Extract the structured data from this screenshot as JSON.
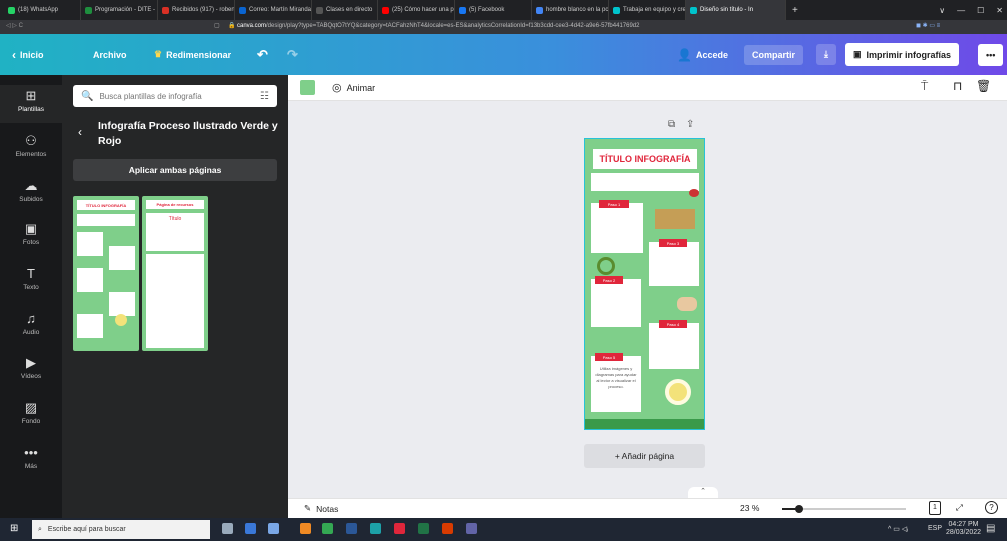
{
  "browser": {
    "tabs": [
      {
        "label": "(18) WhatsApp",
        "color": "#25d366"
      },
      {
        "label": "Programación - DITE - D",
        "color": "#1e8e3e"
      },
      {
        "label": "Recibidos (917) - roberto",
        "color": "#d93025"
      },
      {
        "label": "Correo: Martín Miranda",
        "color": "#0a64d0"
      },
      {
        "label": "Clases en directo",
        "color": "#555555"
      },
      {
        "label": "(25) Cómo hacer una pr",
        "color": "#ff0000"
      },
      {
        "label": "(5) Facebook",
        "color": "#1877f2"
      },
      {
        "label": "hombre blanco en la pc",
        "color": "#4285f4"
      },
      {
        "label": "Trabaja en equipo y crea",
        "color": "#00c4cc"
      },
      {
        "label": "Diseño sin título - In",
        "color": "#00c4cc"
      }
    ],
    "window_controls": [
      "∨",
      "—",
      "☐",
      "✕"
    ],
    "url_domain": "canva.com",
    "url_path": "/design/play?type=TABQqtO7tYQ&category=tACFahzNhT4&locale=es-ES&analyticsCorrelationId=f13b3cdd-cee3-4d42-a9e6-57fb441769d2"
  },
  "toolbar": {
    "home_label": "Inicio",
    "file_label": "Archivo",
    "resize_label": "Redimensionar",
    "undo_icon": "undo-icon",
    "redo_icon": "redo-icon",
    "account_label": "Accede",
    "share_label": "Compartir",
    "print_label": "Imprimir infografías",
    "more_label": "•••"
  },
  "rail": {
    "items": [
      {
        "label": "Plantillas",
        "glyph": "⊞"
      },
      {
        "label": "Elementos",
        "glyph": "⚇"
      },
      {
        "label": "Subidos",
        "glyph": "☁"
      },
      {
        "label": "Fotos",
        "glyph": "▣"
      },
      {
        "label": "Texto",
        "glyph": "T"
      },
      {
        "label": "Audio",
        "glyph": "♫"
      },
      {
        "label": "Vídeos",
        "glyph": "▶"
      },
      {
        "label": "Fondo",
        "glyph": "▨"
      },
      {
        "label": "Más",
        "glyph": "•••"
      }
    ]
  },
  "panel": {
    "search_placeholder": "Busca plantillas de infografía",
    "template_title": "Infografía Proceso Ilustrado Verde y Rojo",
    "apply_label": "Aplicar ambas páginas",
    "thumb1_title": "TÍTULO INFOGRAFÍA",
    "thumb2_title": "Página de recursos",
    "thumb2_sub": "Título"
  },
  "editor": {
    "animate_label": "Animar",
    "color_swatch": "#7fcf8a",
    "infographic_title": "TÍTULO INFOGRAFÍA",
    "steps": [
      "Paso 1",
      "Paso 2",
      "Paso 3",
      "Paso 4",
      "Paso 5"
    ],
    "step5_text": "Utiliza imágenes y diagramas para ayudar al lector a visualizar el proceso.",
    "add_page_label": "+ Añadir página"
  },
  "bottombar": {
    "notes_label": "Notas",
    "zoom_label": "23 %",
    "zoom_fraction": 0.23,
    "page_number": "1"
  },
  "taskbar": {
    "search_placeholder": "Escribe aquí para buscar",
    "language": "ESP",
    "time": "04:27 PM",
    "date": "28/03/2022"
  },
  "colors": {
    "accent_red": "#e0263b",
    "canva_purple": "#6f49e8",
    "canva_teal": "#20b2c4",
    "template_green": "#7fcf8a"
  }
}
